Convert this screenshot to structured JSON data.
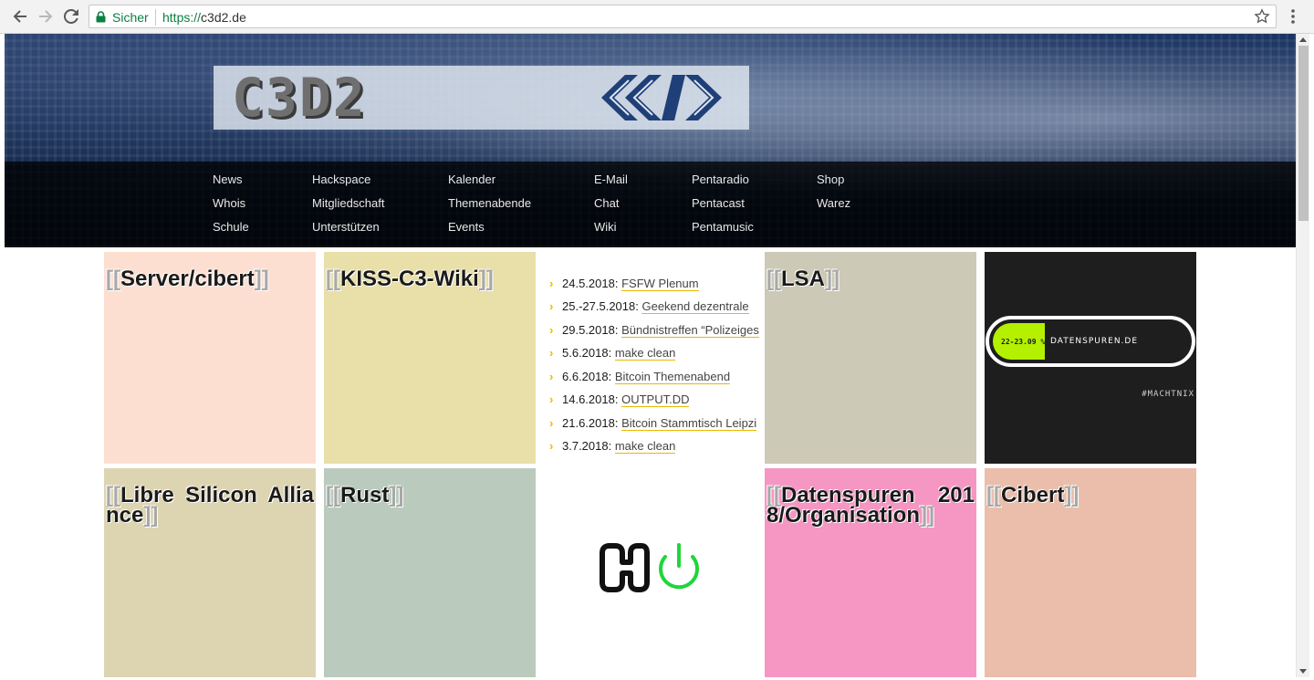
{
  "browser": {
    "secure_label": "Sicher",
    "url_scheme": "https://",
    "url_host": "c3d2.de"
  },
  "header": {
    "logo_text": "C3D2",
    "nav_columns": [
      [
        "News",
        "Whois",
        "Schule"
      ],
      [
        "Hackspace",
        "Mitgliedschaft",
        "Unterstützen"
      ],
      [
        "Kalender",
        "Themenabende",
        "Events"
      ],
      [
        "E-Mail",
        "Chat",
        "Wiki"
      ],
      [
        "Pentaradio",
        "Pentacast",
        "Pentamusic"
      ],
      [
        "Shop",
        "Warez"
      ]
    ]
  },
  "tiles": [
    {
      "title": "Server/cibert",
      "color": "#fddfd2"
    },
    {
      "title": "KISS-C3-Wiki",
      "color": "#e8dfa9"
    },
    {
      "title": "LSA",
      "color": "#cdc9b7"
    },
    {
      "title": "Libre Silicon Alliance",
      "color": "#ddd5b2"
    },
    {
      "title": "Rust",
      "color": "#bacbbd"
    },
    {
      "title": "Datenspuren 2018/Organisation",
      "color": "#f696c3"
    },
    {
      "title": "Cibert",
      "color": "#ebbeac"
    }
  ],
  "brackets": {
    "open": "[[",
    "close": "]]"
  },
  "events": [
    {
      "date": "24.5.2018:",
      "title": "FSFW Plenum"
    },
    {
      "date": "25.-27.5.2018:",
      "title": "Geekend dezentrale"
    },
    {
      "date": "29.5.2018:",
      "title": "Bündnistreffen “Polizeiges"
    },
    {
      "date": "5.6.2018:",
      "title": "make clean"
    },
    {
      "date": "6.6.2018:",
      "title": "Bitcoin Themenabend"
    },
    {
      "date": "14.6.2018:",
      "title": "OUTPUT.DD"
    },
    {
      "date": "21.6.2018:",
      "title": "Bitcoin Stammtisch Leipzi"
    },
    {
      "date": "3.7.2018:",
      "title": "make clean"
    }
  ],
  "datenspuren": {
    "dates": "22-23.09 %",
    "site": "DATENSPUREN.DE",
    "hashtag": "#MACHTNIX",
    "accent": "#b4f000"
  },
  "colors": {
    "accent_yellow": "#e8b900",
    "secure_green": "#0b8043",
    "power_green": "#1fd63a"
  }
}
